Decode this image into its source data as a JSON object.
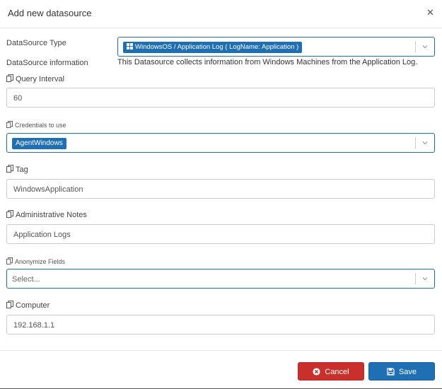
{
  "modal": {
    "title": "Add new datasource",
    "close_icon": "close-icon"
  },
  "fields": {
    "datasource_type": {
      "label": "DataSource Type",
      "selected": "WindowsOS / Application Log ( LogName: Application )",
      "icon": "windows-icon"
    },
    "datasource_info": {
      "label": "DataSource information",
      "text": "This Datasource collects information from Windows Machines from the Application Log."
    },
    "query_interval": {
      "label": "Query Interval",
      "value": "60"
    },
    "credentials": {
      "label": "Credentials to use",
      "selected": "AgentWindows"
    },
    "tag": {
      "label": "Tag",
      "value": "WindowsApplication"
    },
    "admin_notes": {
      "label": "Administrative Notes",
      "value": "Application Logs"
    },
    "anonymize": {
      "label": "Anonymize Fields",
      "placeholder": "Select..."
    },
    "computer": {
      "label": "Computer",
      "value": "192.168.1.1"
    }
  },
  "footer": {
    "cancel_label": "Cancel",
    "save_label": "Save"
  },
  "colors": {
    "primary": "#1f6fb4",
    "danger": "#c9302c"
  }
}
